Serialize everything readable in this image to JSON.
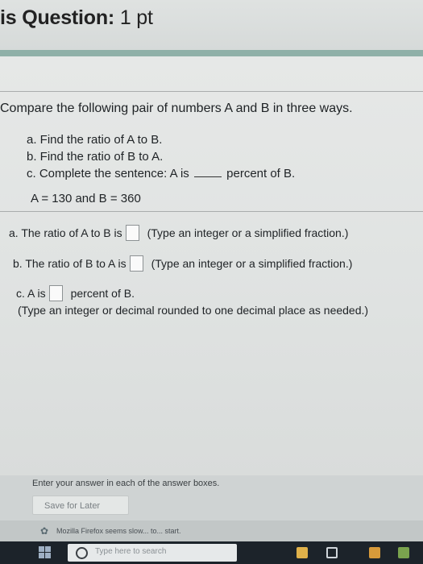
{
  "header": {
    "title": "is Question:",
    "points": "1 pt"
  },
  "question": {
    "prompt": "Compare the following pair of numbers A and B in three ways.",
    "parts": [
      "a. Find the ratio of A to B.",
      "b. Find the ratio of B to A.",
      {
        "prefix": "c. Complete the sentence: A is",
        "suffix": "percent of B."
      }
    ],
    "given": "A = 130 and B = 360"
  },
  "answers": {
    "a": {
      "label": "a. The ratio of A to B is",
      "hint": "(Type an integer or a simplified fraction.)",
      "value": ""
    },
    "b": {
      "label": "b. The ratio of B to A is",
      "hint": "(Type an integer or a simplified fraction.)",
      "value": ""
    },
    "c": {
      "label": "c. A is",
      "suffix": "percent of B.",
      "hint": "(Type an integer or decimal rounded to one decimal place as needed.)",
      "value": ""
    }
  },
  "footer": {
    "instruction": "Enter your answer in each of the answer boxes.",
    "save_label": "Save for Later"
  },
  "notification": {
    "message": "Mozilla Firefox seems slow... to... start."
  },
  "taskbar": {
    "search_placeholder": "Type here to search"
  },
  "colors": {
    "accent_strip": "#8fb0a8",
    "taskbar": "#1c232a"
  }
}
